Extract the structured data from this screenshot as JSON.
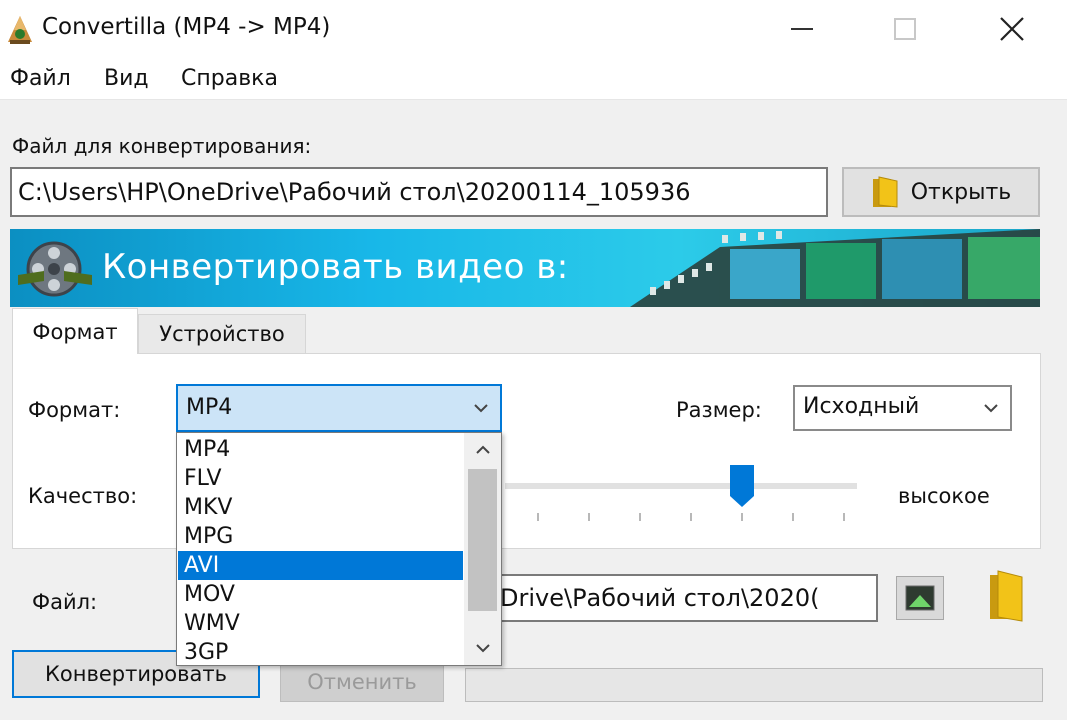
{
  "window": {
    "title": "Convertilla  (MP4 -> MP4)",
    "controls": [
      "minimize",
      "maximize",
      "close"
    ]
  },
  "menu": {
    "items": [
      "Файл",
      "Вид",
      "Справка"
    ]
  },
  "source": {
    "label": "Файл для конвертирования:",
    "path": "C:\\Users\\HP\\OneDrive\\Рабочий стол\\20200114_105936",
    "open_button": "Открыть"
  },
  "banner": {
    "title": "Конвертировать видео в:"
  },
  "tabs": [
    {
      "label": "Формат",
      "active": true
    },
    {
      "label": "Устройство",
      "active": false
    }
  ],
  "format": {
    "label": "Формат:",
    "selected": "MP4",
    "options": [
      "MP4",
      "FLV",
      "MKV",
      "MPG",
      "AVI",
      "MOV",
      "WMV",
      "3GP"
    ],
    "highlighted": "AVI"
  },
  "size": {
    "label": "Размер:",
    "selected": "Исходный"
  },
  "quality": {
    "label": "Качество:",
    "max_label": "высокое",
    "level_fraction": 0.67
  },
  "output": {
    "label": "Файл:",
    "path": "Drive\\Рабочий стол\\2020("
  },
  "actions": {
    "convert": "Конвертировать",
    "cancel": "Отменить"
  },
  "colors": {
    "accent": "#0078d7",
    "banner": "#18b7e8",
    "selection": "#cce4f7"
  },
  "icons": [
    "app-icon",
    "folder-icon",
    "film-reel-icon",
    "play-preview-icon",
    "chevron-down-icon",
    "scroll-up-icon",
    "scroll-down-icon"
  ]
}
